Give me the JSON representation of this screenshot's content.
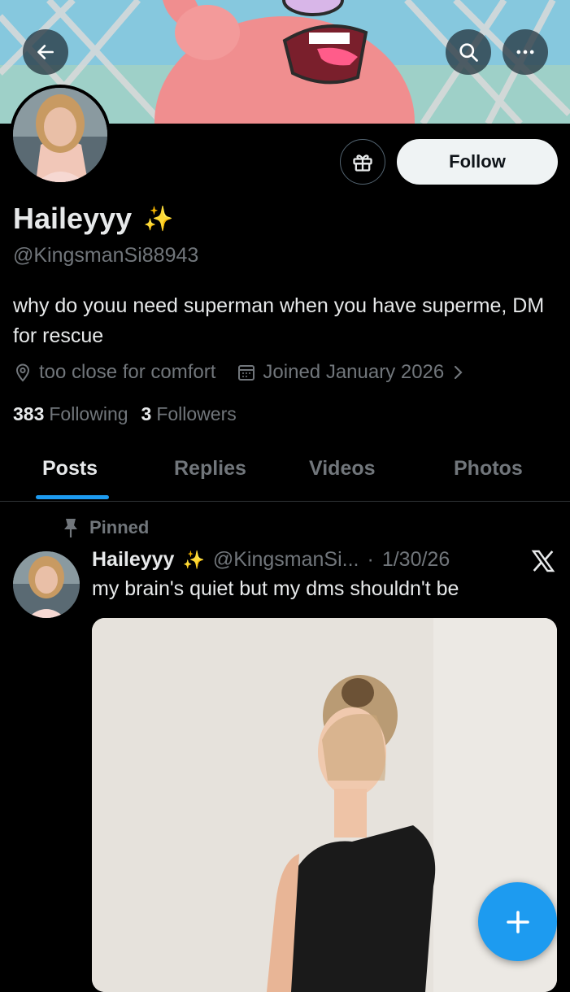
{
  "colors": {
    "accent": "#1d9bf0",
    "background": "#000000",
    "text": "#e7e9ea",
    "muted": "#71767b",
    "follow_bg": "#eff3f4"
  },
  "header": {
    "back_icon": "arrow-left-icon",
    "search_icon": "search-icon",
    "more_icon": "more-horizontal-icon"
  },
  "profile": {
    "display_name": "Haileyyy",
    "name_emoji": "✨",
    "handle": "@KingsmanSi88943",
    "bio": "why do youu need superman when you have superme, DM for rescue",
    "location": "too close for comfort",
    "joined": "Joined January 2026",
    "following_count": "383",
    "following_label": "Following",
    "followers_count": "3",
    "followers_label": "Followers",
    "follow_button": "Follow",
    "gift_icon": "gift-icon"
  },
  "tabs": [
    {
      "label": "Posts",
      "active": true
    },
    {
      "label": "Replies",
      "active": false
    },
    {
      "label": "Videos",
      "active": false
    },
    {
      "label": "Photos",
      "active": false
    }
  ],
  "post": {
    "pinned_label": "Pinned",
    "author_name": "Haileyyy",
    "author_emoji": "✨",
    "author_handle": "@KingsmanSi...",
    "separator": "·",
    "date": "1/30/26",
    "text": "my brain's quiet but my dms shouldn't be",
    "source_icon": "x-logo-icon"
  },
  "fab": {
    "icon": "plus-icon"
  }
}
